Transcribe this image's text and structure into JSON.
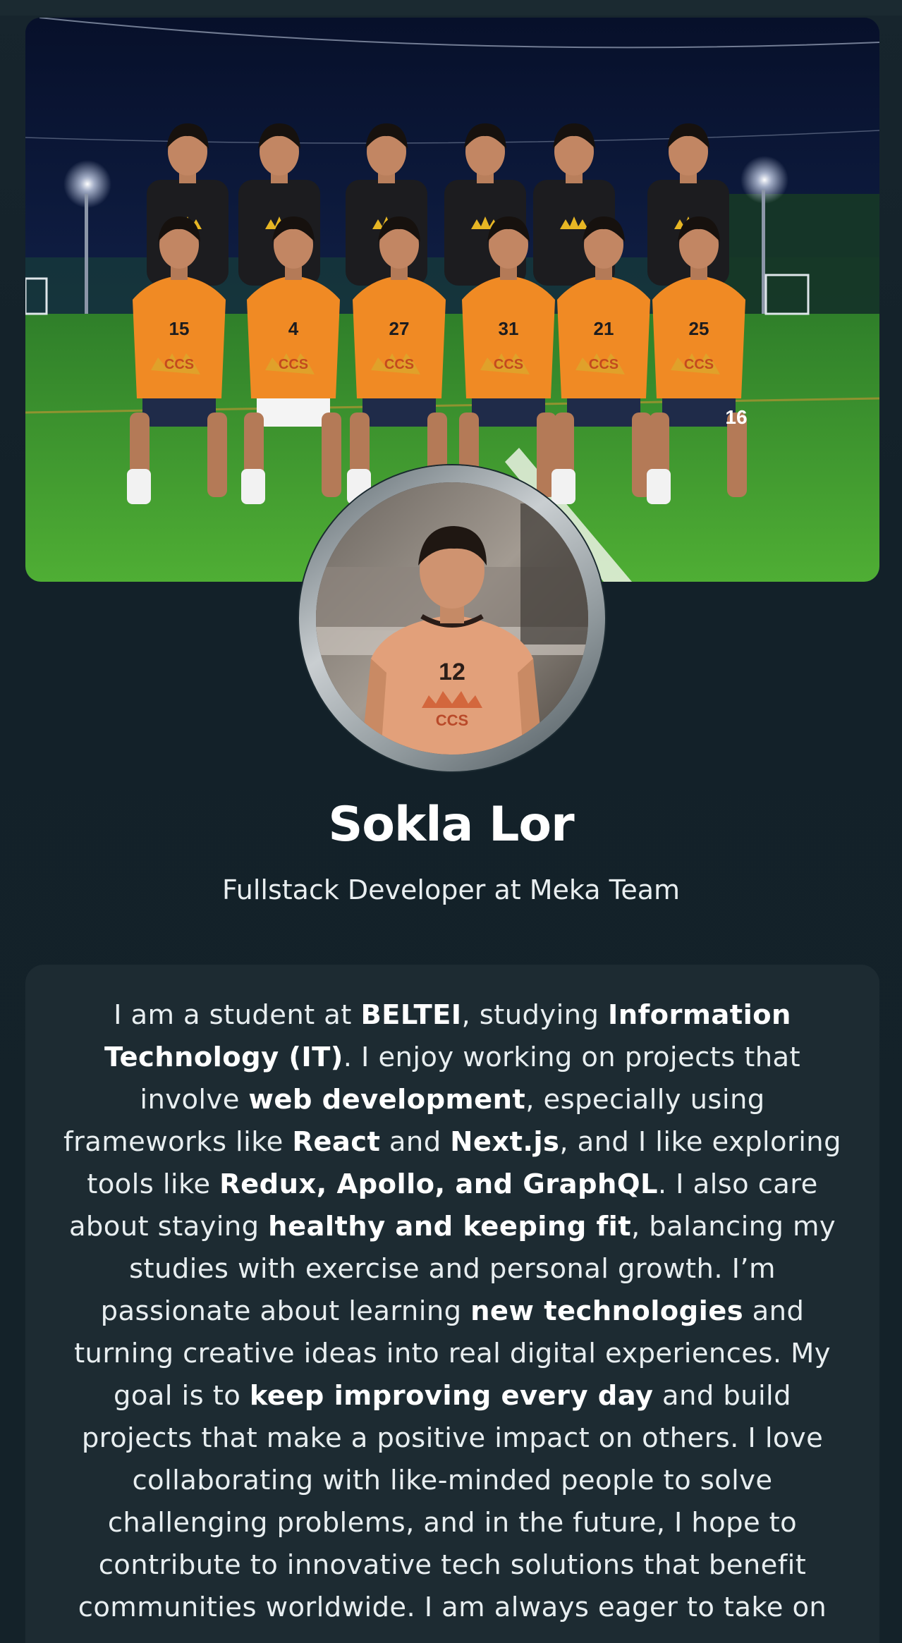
{
  "profile": {
    "name": "Sokla Lor",
    "role": "Fullstack Developer at Meka Team"
  },
  "cover": {
    "description_icon": "team-photo",
    "jersey_numbers": [
      "15",
      "4",
      "27",
      "31",
      "21",
      "25",
      "16"
    ],
    "jersey_badge": "CCS"
  },
  "avatar": {
    "jersey_number": "12",
    "jersey_badge": "CCS"
  },
  "bio": {
    "segments": [
      {
        "text": "I am a student at ",
        "bold": false
      },
      {
        "text": "BELTEI",
        "bold": true
      },
      {
        "text": ", studying ",
        "bold": false
      },
      {
        "text": "Information Technology (IT)",
        "bold": true
      },
      {
        "text": ". I enjoy working on projects that involve ",
        "bold": false
      },
      {
        "text": "web development",
        "bold": true
      },
      {
        "text": ", especially using frameworks like ",
        "bold": false
      },
      {
        "text": "React",
        "bold": true
      },
      {
        "text": " and ",
        "bold": false
      },
      {
        "text": "Next.js",
        "bold": true
      },
      {
        "text": ", and I like exploring tools like ",
        "bold": false
      },
      {
        "text": "Redux, Apollo, and GraphQL",
        "bold": true
      },
      {
        "text": ". I also care about staying ",
        "bold": false
      },
      {
        "text": "healthy and keeping fit",
        "bold": true
      },
      {
        "text": ", balancing my studies with exercise and personal growth. I’m passionate about learning ",
        "bold": false
      },
      {
        "text": "new technologies",
        "bold": true
      },
      {
        "text": " and turning creative ideas into real digital experiences. My goal is to ",
        "bold": false
      },
      {
        "text": "keep improving every day",
        "bold": true
      },
      {
        "text": " and build projects that make a positive impact on others. I love collaborating with like-minded people to solve challenging problems, and in the future, I hope to contribute to innovative tech solutions that benefit communities worldwide. I am always eager to take on",
        "bold": false
      }
    ]
  },
  "colors": {
    "background": "#132129",
    "card": "#1d2b32",
    "jersey_orange": "#f08a24",
    "jersey_black": "#1c1c1f",
    "pitch_green": "#3f9a2e"
  }
}
